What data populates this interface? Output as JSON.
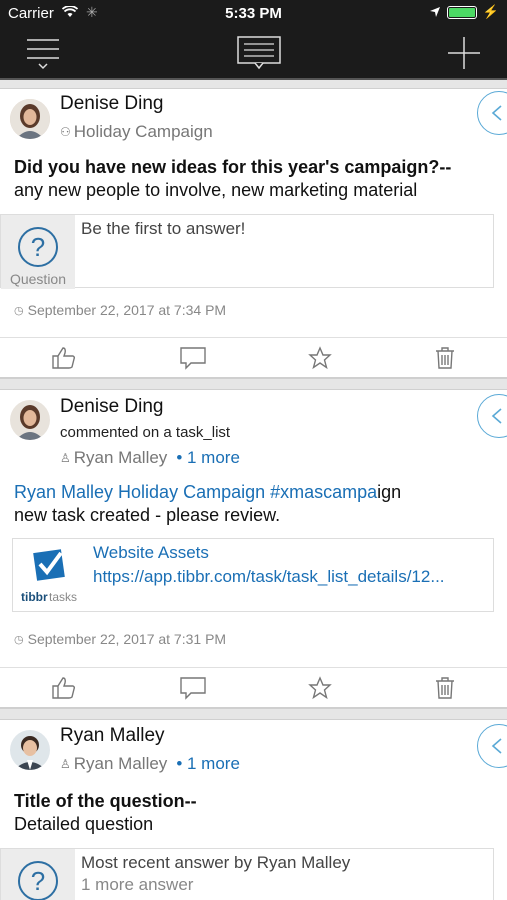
{
  "status": {
    "carrier": "Carrier",
    "time": "5:33 PM"
  },
  "posts": [
    {
      "author": "Denise Ding",
      "group": "Holiday Campaign",
      "title": "Did you have new ideas for this year's campaign?--",
      "body": "any new people to involve, new marketing material",
      "qa_label": "Question",
      "qa_text": "Be the first to answer!",
      "timestamp": "September 22, 2017 at 7:34 PM"
    },
    {
      "author": "Denise Ding",
      "action": "commented on a task_list",
      "mention": "Ryan Malley",
      "more": "• 1 more",
      "link_line_blue": "Ryan Malley Holiday Campaign #xmascampa",
      "link_line_rest": "ign",
      "body": "new task created - please review.",
      "attachment_title": "Website Assets",
      "attachment_url": "https://app.tibbr.com/task/task_list_details/12...",
      "logo_text_bold": "tibbr",
      "logo_text_light": "tasks",
      "timestamp": "September 22, 2017 at 7:31 PM"
    },
    {
      "author": "Ryan Malley",
      "mention": "Ryan Malley",
      "more": "• 1 more",
      "title": "Title of the question--",
      "body": "Detailed question",
      "qa_text": "Most recent answer by Ryan Malley",
      "qa_sub": "1 more answer"
    }
  ],
  "colors": {
    "accent": "#1a6fb5",
    "nav": "#1b1b1b",
    "battery": "#4cd964"
  },
  "icons": [
    "menu-icon",
    "compose-icon",
    "add-icon",
    "like-icon",
    "comment-icon",
    "star-icon",
    "delete-icon",
    "question-icon",
    "clock-icon",
    "group-icon",
    "user-icon",
    "chevron-left-icon"
  ]
}
